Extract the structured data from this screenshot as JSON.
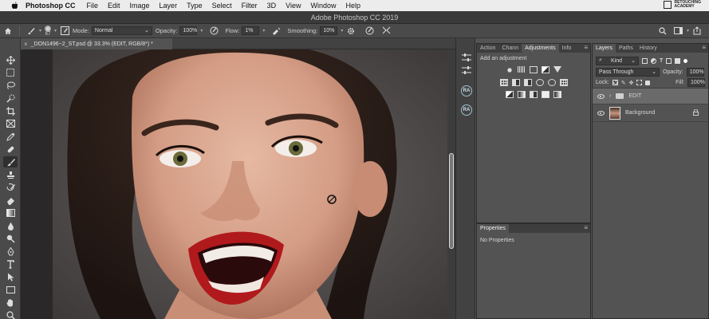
{
  "menubar": {
    "app": "Photoshop CC",
    "items": [
      "File",
      "Edit",
      "Image",
      "Layer",
      "Type",
      "Select",
      "Filter",
      "3D",
      "View",
      "Window",
      "Help"
    ],
    "brand_line1": "RETOUCHING",
    "brand_line2": "ACADEMY"
  },
  "titlebar": {
    "title": "Adobe Photoshop CC 2019"
  },
  "options": {
    "brush_size": "67",
    "mode_label": "Mode:",
    "mode_value": "Normal",
    "opacity_label": "Opacity:",
    "opacity_value": "100%",
    "flow_label": "Flow:",
    "flow_value": "1%",
    "smoothing_label": "Smoothing:",
    "smoothing_value": "10%"
  },
  "document": {
    "tab_label": "_DON1496~2_ST.psd @ 33.3% (EDIT, RGB/8*) *"
  },
  "side_icons": [
    "RA",
    "RA"
  ],
  "adjustments_panel": {
    "tabs": [
      "Action",
      "Chann",
      "Adjustments",
      "Info"
    ],
    "active_tab": "Adjustments",
    "heading": "Add an adjustment"
  },
  "properties_panel": {
    "title": "Properties",
    "content": "No Properties"
  },
  "layers_panel": {
    "tabs": [
      "Layers",
      "Paths",
      "History"
    ],
    "active_tab": "Layers",
    "filter_label": "Kind",
    "blend_mode": "Pass Through",
    "opacity_label": "Opacity:",
    "opacity_value": "100%",
    "lock_label": "Lock:",
    "fill_label": "Fill:",
    "fill_value": "100%",
    "layers": [
      {
        "name": "EDIT",
        "type": "group"
      },
      {
        "name": "Background",
        "type": "image"
      }
    ]
  }
}
